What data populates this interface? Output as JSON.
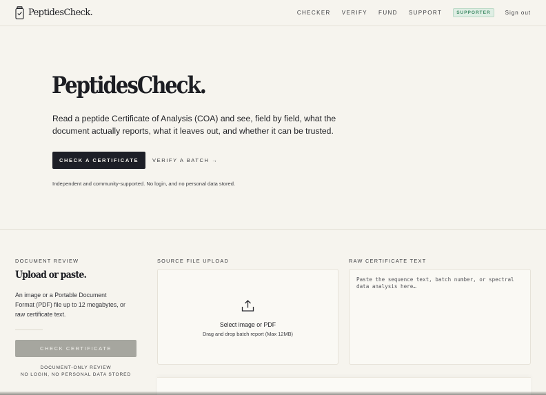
{
  "nav": {
    "brand": "PeptidesCheck.",
    "links": [
      "CHECKER",
      "VERIFY",
      "FUND",
      "SUPPORT"
    ],
    "badge": "SUPPORTER",
    "signout": "Sign out"
  },
  "hero": {
    "title": "PeptidesCheck.",
    "description": "Read a peptide Certificate of Analysis (COA) and see, field by field, what the document actually reports, what it leaves out, and whether it can be trusted.",
    "primary_button": "CHECK A CERTIFICATE",
    "secondary_link": "VERIFY A BATCH →",
    "note": "Independent and community-supported. No login, and no personal data stored."
  },
  "review": {
    "label": "DOCUMENT REVIEW",
    "title": "Upload or paste.",
    "description": "An image or a Portable Document Format (PDF) file up to 12 megabytes, or raw certificate text.",
    "button": "CHECK CERTIFICATE",
    "note_line1": "DOCUMENT-ONLY REVIEW",
    "note_line2": "NO LOGIN, NO PERSONAL DATA STORED"
  },
  "upload": {
    "label": "SOURCE FILE UPLOAD",
    "icon": "upload-icon",
    "main": "Select image or PDF",
    "sub": "Drag and drop batch report (Max 12MB)"
  },
  "raw": {
    "label": "RAW CERTIFICATE TEXT",
    "placeholder": "Paste the sequence text, batch number, or spectral data analysis here…"
  },
  "colors": {
    "background": "#f6f4ee",
    "primary": "#1d1f27",
    "badge_green": "#3f8a65",
    "disabled": "#a6a69f"
  }
}
